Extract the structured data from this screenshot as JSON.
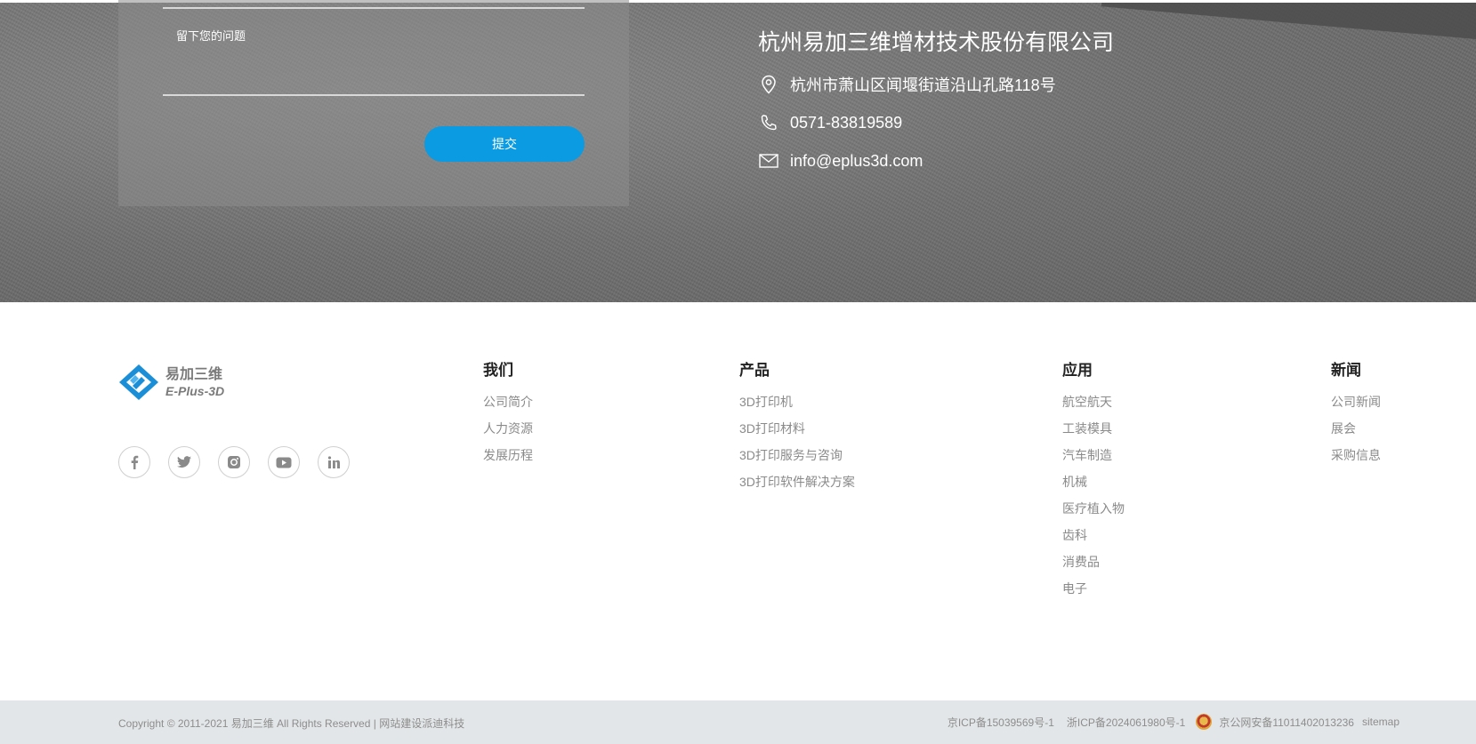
{
  "contact": {
    "message_placeholder": "留下您的问题",
    "submit_label": "提交",
    "company_name": "杭州易加三维增材技术股份有限公司",
    "address": "杭州市萧山区闻堰街道沿山孔路118号",
    "phone": "0571-83819589",
    "email": "info@eplus3d.com"
  },
  "footer": {
    "logo": {
      "cn": "易加三维",
      "en": "E-Plus-3D"
    },
    "socials": [
      "facebook-icon",
      "twitter-icon",
      "instagram-icon",
      "youtube-icon",
      "linkedin-icon"
    ],
    "columns": {
      "we": {
        "title": "我们",
        "links": [
          "公司简介",
          "人力资源",
          "发展历程"
        ]
      },
      "products": {
        "title": "产品",
        "links": [
          "3D打印机",
          "3D打印材料",
          "3D打印服务与咨询",
          "3D打印软件解决方案"
        ]
      },
      "apps": {
        "title": "应用",
        "links": [
          "航空航天",
          "工装模具",
          "汽车制造",
          "机械",
          "医疗植入物",
          "齿科",
          "消费品",
          "电子"
        ]
      },
      "news": {
        "title": "新闻",
        "links": [
          "公司新闻",
          "展会",
          "采购信息"
        ]
      }
    }
  },
  "bottom": {
    "copyright": "Copyright © 2011-2021 易加三维 All Rights Reserved | ",
    "builder_link": "网站建设派迪科技",
    "icp1": "京ICP备15039569号-1",
    "icp2": "浙ICP备2024061980号-1",
    "police": "京公网安备11011402013236",
    "sitemap": "sitemap"
  },
  "colors": {
    "accent": "#0a9be3",
    "logo_blue": "#1a8fd8"
  }
}
